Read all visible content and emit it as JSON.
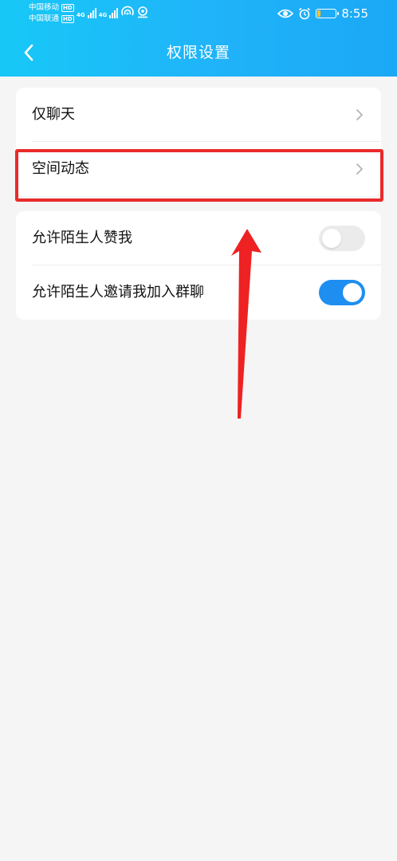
{
  "status_bar": {
    "carrier_1": "中国移动",
    "carrier_1_badge": "HD",
    "carrier_2": "中国联通",
    "carrier_2_badge": "HD",
    "net_type_1": "4G",
    "net_type_2": "4G",
    "time": "8:55",
    "battery_color": "#f7c12c"
  },
  "header": {
    "title": "权限设置",
    "back_icon": "chevron-left-icon",
    "gradient_start": "#17c8f7",
    "gradient_end": "#1ba8f6"
  },
  "menu": {
    "items": [
      {
        "label": "仅聊天",
        "icon": "chevron-right-icon"
      },
      {
        "label": "空间动态",
        "icon": "chevron-right-icon",
        "highlighted": true
      }
    ]
  },
  "toggles": {
    "items": [
      {
        "label": "允许陌生人赞我",
        "on": false
      },
      {
        "label": "允许陌生人邀请我加入群聊",
        "on": true
      }
    ],
    "on_color": "#1e8ef0",
    "off_color": "#ebebeb"
  },
  "annotation": {
    "highlight_color": "#ea2a2a"
  }
}
